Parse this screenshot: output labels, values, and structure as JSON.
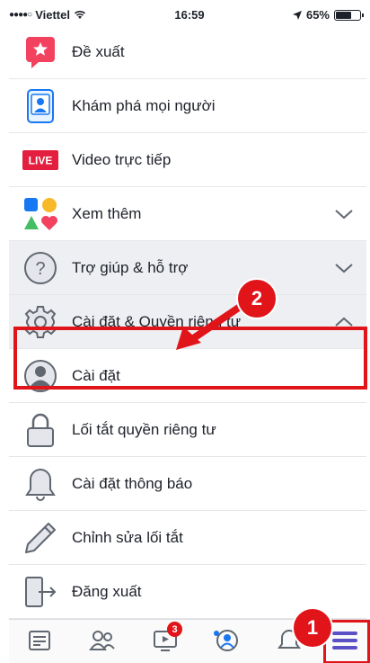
{
  "status_bar": {
    "signal": "●●●●○",
    "carrier": "Viettel",
    "time": "16:59",
    "battery_percent": "65%"
  },
  "menu": {
    "items": [
      {
        "label": "Đề xuất",
        "icon": "star-bubble-icon"
      },
      {
        "label": "Khám phá mọi người",
        "icon": "person-card-icon"
      },
      {
        "label": "Video trực tiếp",
        "icon": "live-badge-icon",
        "badge_text": "LIVE"
      },
      {
        "label": "Xem thêm",
        "icon": "shapes-icon",
        "expandable": true,
        "expanded": false
      },
      {
        "label": "Trợ giúp & hỗ trợ",
        "icon": "help-icon",
        "expandable": true,
        "expanded": false
      },
      {
        "label": "Cài đặt & Quyền riêng tư",
        "icon": "gear-icon",
        "expandable": true,
        "expanded": true
      },
      {
        "label": "Cài đặt",
        "icon": "profile-icon",
        "highlighted": true
      },
      {
        "label": "Lối tắt quyền riêng tư",
        "icon": "lock-icon"
      },
      {
        "label": "Cài đặt thông báo",
        "icon": "bell-icon"
      },
      {
        "label": "Chỉnh sửa lối tắt",
        "icon": "pencil-icon"
      },
      {
        "label": "Đăng xuất",
        "icon": "logout-door-icon"
      }
    ]
  },
  "annotations": {
    "step1": "1",
    "step2": "2"
  },
  "tabbar": {
    "tabs": [
      "news-feed-icon",
      "friends-icon",
      "watch-icon",
      "groups-icon",
      "notifications-icon",
      "menu-icon"
    ],
    "watch_badge": "3"
  },
  "colors": {
    "accent_red": "#e1141a",
    "facebook_purple": "#5b51c7",
    "icon_gray": "#606770"
  }
}
